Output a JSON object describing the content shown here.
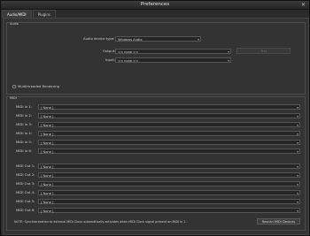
{
  "window": {
    "title": "Preferences",
    "close_glyph": "✕"
  },
  "tabs": [
    {
      "label": "Audio/MIDI",
      "active": true
    },
    {
      "label": "Plugins",
      "active": false
    }
  ],
  "audio": {
    "group_label": "Audio",
    "device_type_label": "Audio device type:",
    "device_type_value": "Windows Audio",
    "output_label": "Output:",
    "output_value": "<< none >>",
    "test_button": "Test",
    "input_label": "Input:",
    "input_value": "<< none >>",
    "multithreaded_label": "Multithreaded Rendering",
    "multithreaded_checked": true
  },
  "midi": {
    "group_label": "MIDI",
    "inputs": [
      {
        "label": "MIDI In 1:",
        "value": "[ None ]"
      },
      {
        "label": "MIDI In 2:",
        "value": "[ None ]"
      },
      {
        "label": "MIDI In 3:",
        "value": "[ None ]"
      },
      {
        "label": "MIDI In 4:",
        "value": "[ None ]"
      },
      {
        "label": "MIDI In 5:",
        "value": "[ None ]"
      },
      {
        "label": "MIDI In 6:",
        "value": "[ None ]"
      }
    ],
    "outputs": [
      {
        "label": "MIDI Out 1:",
        "value": "[ None ]"
      },
      {
        "label": "MIDI Out 2:",
        "value": "[ None ]"
      },
      {
        "label": "MIDI Out 3:",
        "value": "[ None ]"
      },
      {
        "label": "MIDI Out 4:",
        "value": "[ None ]"
      },
      {
        "label": "MIDI Out 5:",
        "value": "[ None ]"
      },
      {
        "label": "MIDI Out 6:",
        "value": "[ None ]"
      }
    ],
    "note": "NOTE: Synchronization to external MIDI Clock automatically activates when MIDI Clock signal present on MIDI In 1.",
    "rescan_button": "Rescan MIDI Devices"
  }
}
